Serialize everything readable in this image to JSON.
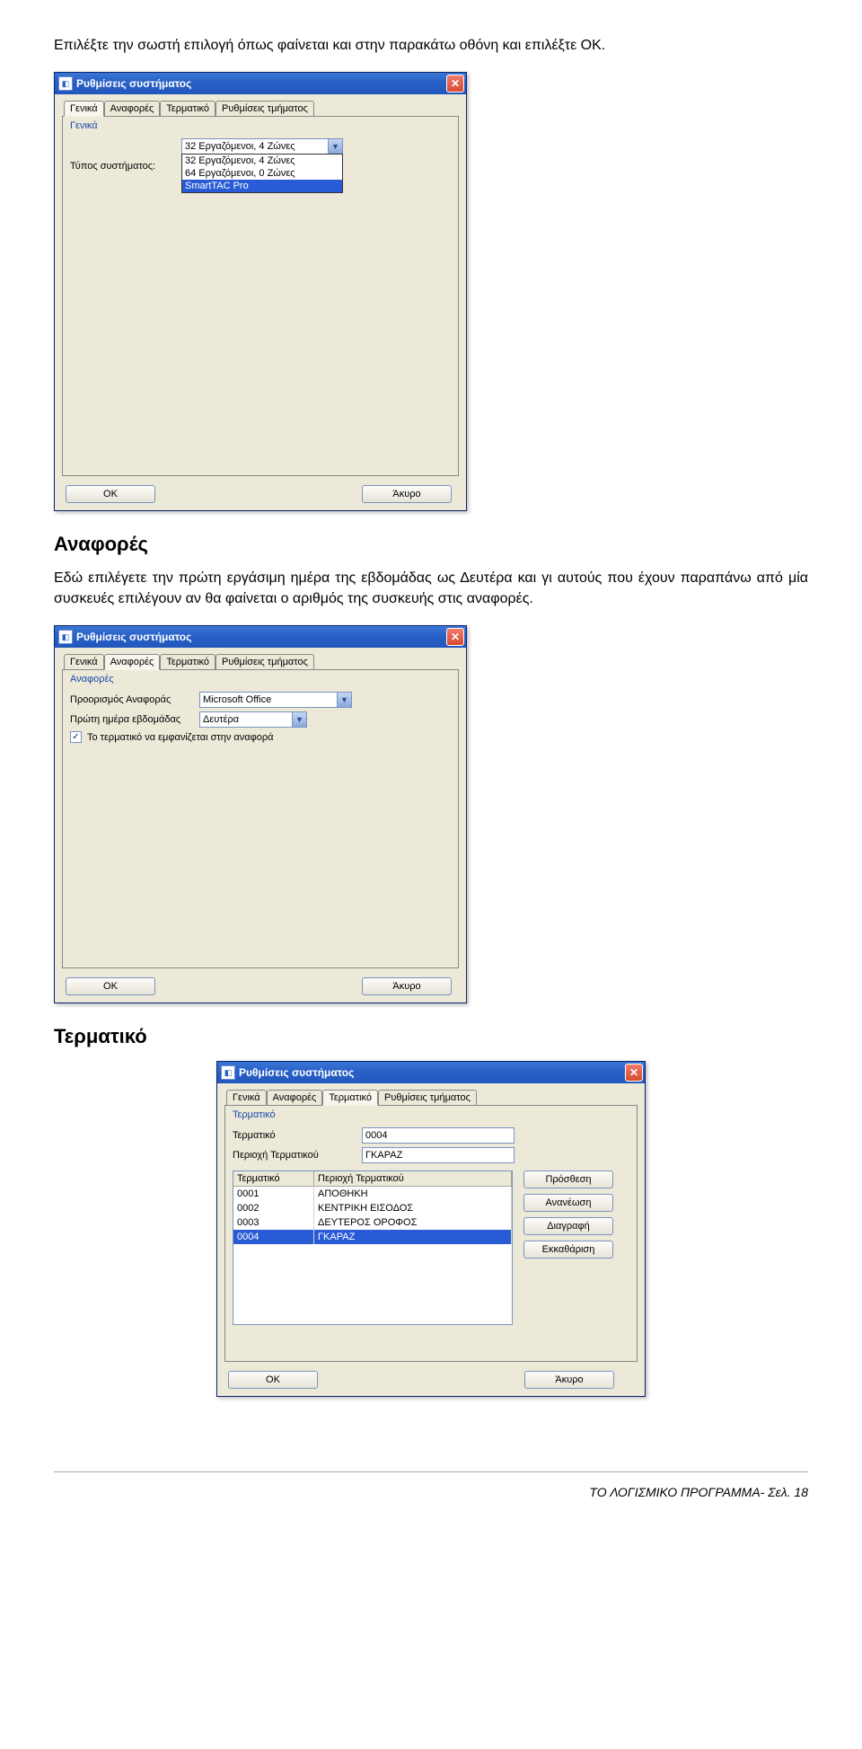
{
  "intro_text": "Επιλέξτε την σωστή επιλογή όπως φαίνεται και στην παρακάτω οθόνη και επιλέξτε ΟΚ.",
  "section_reports_heading": "Αναφορές",
  "section_reports_text": "Εδώ επιλέγετε την πρώτη εργάσιμη ημέρα της εβδομάδας ως Δευτέρα και γι αυτούς που έχουν παραπάνω από μία συσκευές επιλέγουν αν θα φαίνεται  ο αριθμός της συσκευής στις αναφορές.",
  "section_terminal_heading": "Τερματικό",
  "dialog": {
    "title": "Ρυθμίσεις συστήματος",
    "tabs": {
      "general": "Γενικά",
      "reports": "Αναφορές",
      "terminal": "Τερματικό",
      "dept": "Ρυθμίσεις τμήματος"
    },
    "general": {
      "group": "Γενικά",
      "systype_label": "Τύπος συστήματος:",
      "systype_value": "32 Εργαζόμενοι, 4 Ζώνες",
      "options": [
        "32 Εργαζόμενοι, 4 Ζώνες",
        "64 Εργαζόμενοι, 0 Ζώνες",
        "SmartTAC Pro"
      ],
      "selected_index": 2
    },
    "reports": {
      "group": "Αναφορές",
      "dest_label": "Προορισμός Αναφοράς",
      "dest_value": "Microsoft Office",
      "firstday_label": "Πρώτη ημέρα εβδομάδας",
      "firstday_value": "Δευτέρα",
      "check_label": "Το τερματικό να εμφανίζεται στην αναφορά",
      "check_checked": true
    },
    "terminal": {
      "group": "Τερματικό",
      "term_label": "Τερματικό",
      "term_value": "0004",
      "area_label": "Περιοχή Τερματικού",
      "area_value": "ΓΚΑΡΑΖ",
      "columns": {
        "c1": "Τερματικό",
        "c2": "Περιοχή Τερματικού"
      },
      "rows": [
        {
          "id": "0001",
          "area": "ΑΠΟΘΗΚΗ"
        },
        {
          "id": "0002",
          "area": "ΚΕΝΤΡΙΚΗ ΕΙΣΟΔΟΣ"
        },
        {
          "id": "0003",
          "area": "ΔΕΥΤΕΡΟΣ ΟΡΟΦΟΣ"
        },
        {
          "id": "0004",
          "area": "ΓΚΑΡΑΖ"
        }
      ],
      "selected_index": 3,
      "buttons": {
        "add": "Πρόσθεση",
        "renew": "Ανανέωση",
        "delete": "Διαγραφή",
        "clear": "Εκκαθάριση"
      }
    },
    "ok": "OK",
    "cancel": "Άκυρο"
  },
  "footer": "ΤΟ ΛΟΓΙΣΜΙΚΟ ΠΡΟΓΡΑΜΜΑ-  Σελ. 18"
}
